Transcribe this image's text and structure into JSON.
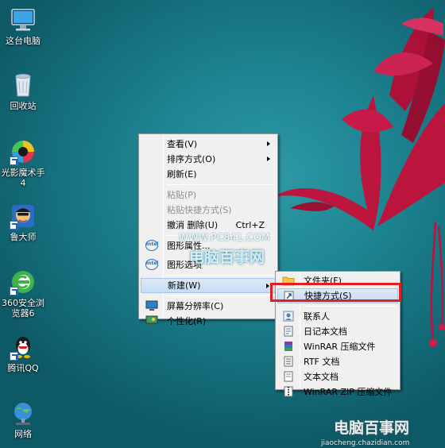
{
  "desktop_icons": [
    {
      "label": "这台电脑",
      "icon": "this-pc-icon"
    },
    {
      "label": "回收站",
      "icon": "recycle-bin-icon"
    },
    {
      "label": "光影魔术手4",
      "icon": "nEOiMAGING-icon"
    },
    {
      "label": "鲁大师",
      "icon": "ludashi-icon"
    },
    {
      "label": "360安全浏览器6",
      "icon": "360-browser-icon"
    },
    {
      "label": "腾讯QQ",
      "icon": "qq-icon"
    },
    {
      "label": "网络",
      "icon": "network-icon"
    }
  ],
  "context_menu": {
    "view": "查看(V)",
    "sort": "排序方式(O)",
    "refresh": "刷新(E)",
    "paste": "粘贴(P)",
    "paste_shortcut": "粘贴快捷方式(S)",
    "undo": "撤消 删除(U)",
    "undo_accel": "Ctrl+Z",
    "graphics_properties": "图形属性...",
    "graphics_options": "图形选项",
    "new": "新建(W)",
    "screen_resolution": "屏幕分辨率(C)",
    "personalize": "个性化(R)"
  },
  "new_submenu": {
    "folder": "文件夹(F)",
    "shortcut": "快捷方式(S)",
    "contact": "联系人",
    "journal": "日记本文档",
    "winrar": "WinRAR 压缩文件",
    "rtf": "RTF 文档",
    "text": "文本文档",
    "winrar_zip": "WinRAR ZIP 压缩文件"
  },
  "watermark": {
    "url": "WWW.PC841.COM",
    "name": "电脑百事网"
  },
  "corner_logo": {
    "name": "电脑百事网",
    "url": "jiaocheng.chazidian.com"
  },
  "colors": {
    "highlight_box": "#e02020",
    "menu_highlight": "#c7dcf4"
  }
}
